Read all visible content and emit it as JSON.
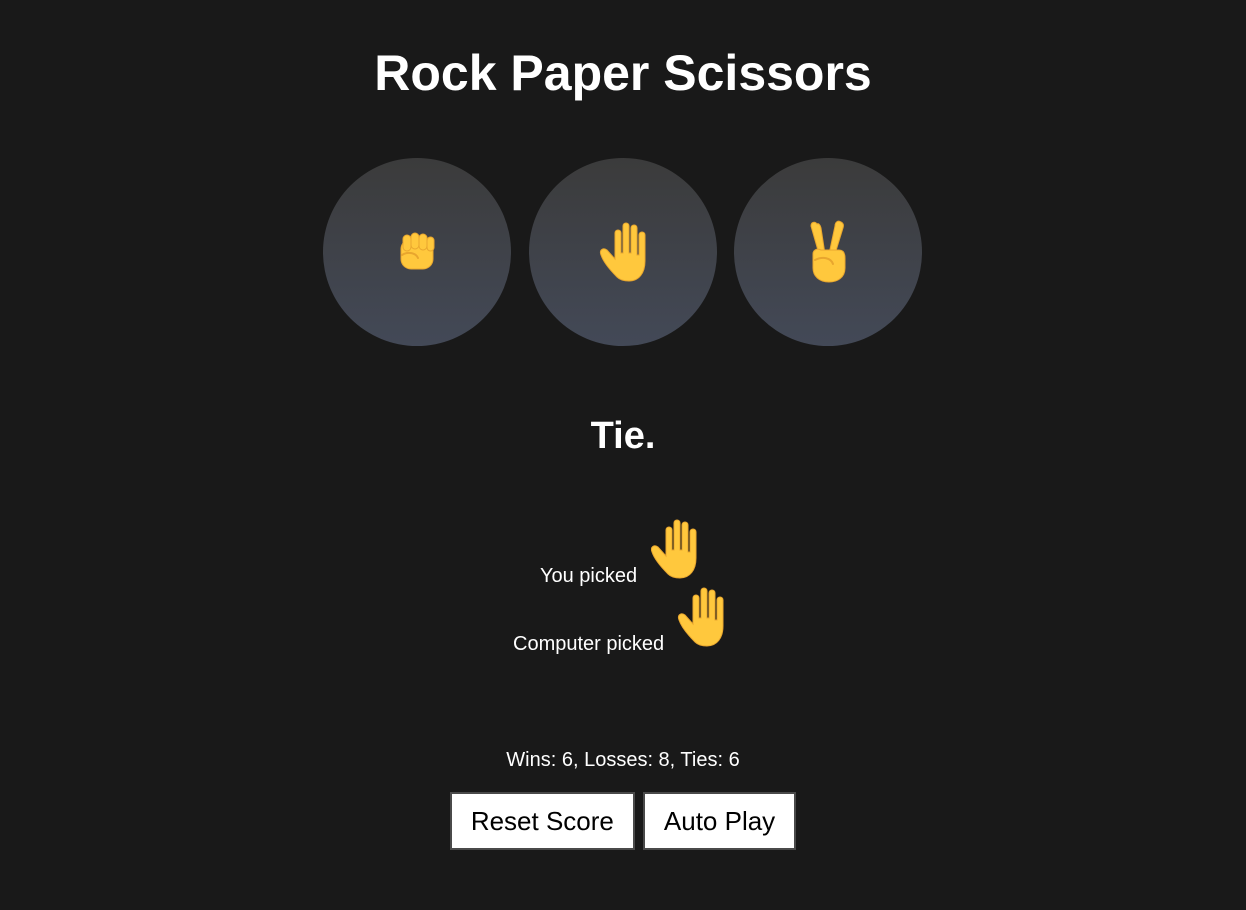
{
  "title": "Rock Paper Scissors",
  "moves": [
    {
      "name": "rock",
      "icon": "raised-fist-icon"
    },
    {
      "name": "paper",
      "icon": "raised-hand-icon"
    },
    {
      "name": "scissors",
      "icon": "victory-hand-icon"
    }
  ],
  "result": "Tie.",
  "you_picked_label": "You picked",
  "you_picked_icon": "raised-hand-icon",
  "computer_picked_label": "Computer picked",
  "computer_picked_icon": "raised-hand-icon",
  "score": "Wins: 6, Losses: 8, Ties: 6",
  "buttons": {
    "reset_label": "Reset Score",
    "auto_play_label": "Auto Play"
  },
  "colors": {
    "background": "#191919",
    "emoji": "#FFC83D"
  }
}
